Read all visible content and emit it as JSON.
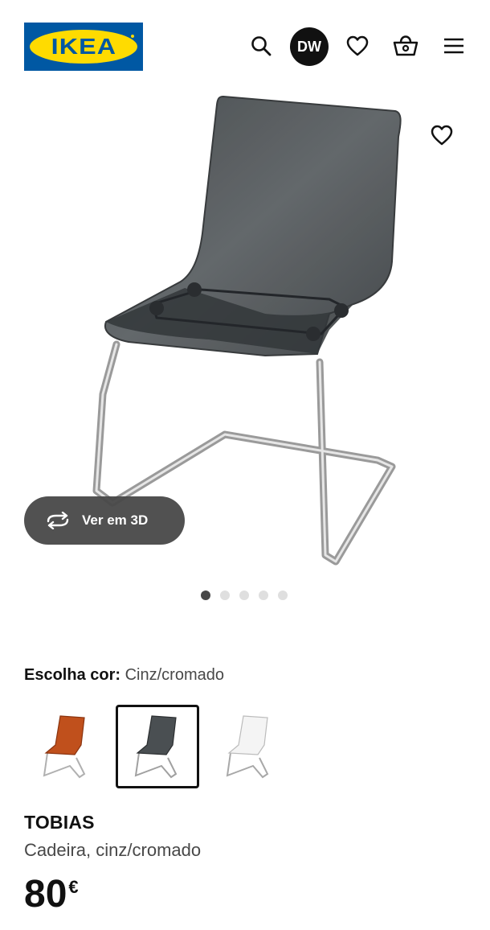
{
  "header": {
    "logo_text": "IKEA",
    "avatar_initials": "DW",
    "icons": [
      "search-icon",
      "heart-icon",
      "shopping-bag-icon",
      "menu-icon"
    ]
  },
  "gallery": {
    "view_3d_label": "Ver em 3D",
    "image_count": 5,
    "active_index": 0
  },
  "product": {
    "color_label": "Escolha cor:",
    "color_value": "Cinz/cromado",
    "swatches": [
      {
        "color": "#b84a1a",
        "selected": false
      },
      {
        "color": "#4a4f52",
        "selected": true
      },
      {
        "color": "#e8e8e8",
        "selected": false
      }
    ],
    "name": "TOBIAS",
    "description": "Cadeira, cinz/cromado",
    "price_integer": "80",
    "price_currency": "€"
  },
  "colors": {
    "brand_blue": "#0058a3",
    "brand_yellow": "#ffdb00",
    "text_primary": "#111111",
    "text_secondary": "#484848"
  }
}
